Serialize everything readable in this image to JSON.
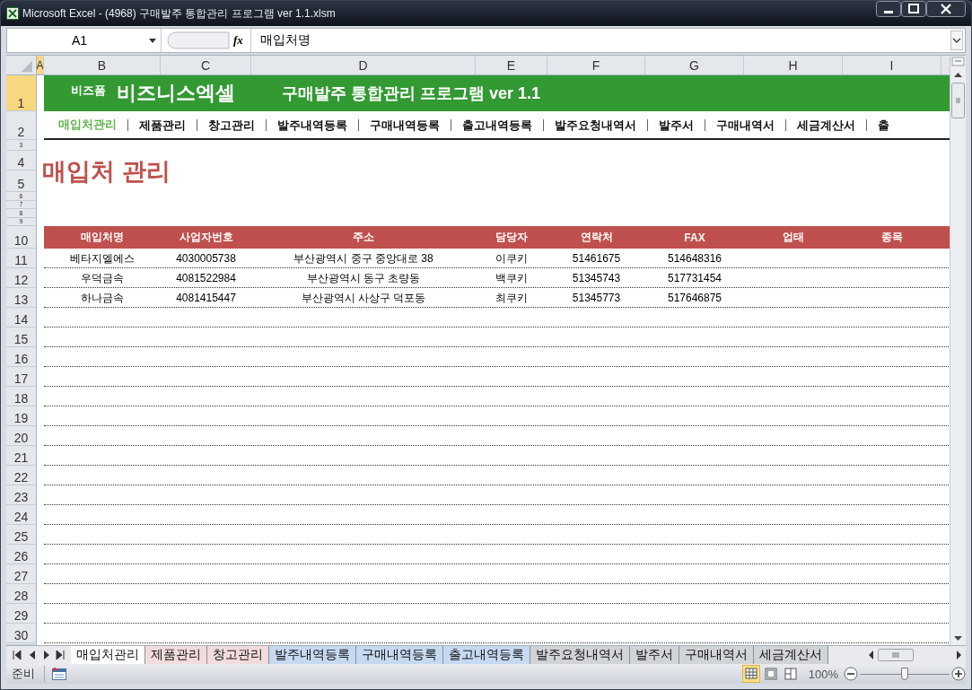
{
  "window": {
    "title": "Microsoft Excel - (4968) 구매발주 통합관리 프로그램 ver 1.1.xlsm"
  },
  "formula_bar": {
    "name_box": "A1",
    "function_button": "fx",
    "formula": "매입처명"
  },
  "column_headers": [
    "A",
    "B",
    "C",
    "D",
    "E",
    "F",
    "G",
    "H",
    "I"
  ],
  "row_headers": [
    "1",
    "2",
    "3",
    "4",
    "5",
    "6",
    "7",
    "8",
    "9",
    "10",
    "11",
    "12",
    "13",
    "14",
    "15",
    "16",
    "17",
    "18",
    "19",
    "20",
    "21",
    "22",
    "23",
    "24",
    "25",
    "26",
    "27",
    "28",
    "29",
    "30"
  ],
  "banner": {
    "brand_small": "비즈폼",
    "brand": "비즈니스엑셀",
    "title": "구매발주 통합관리 프로그램 ver 1.1"
  },
  "nav": [
    {
      "label": "매입처관리",
      "selected": true
    },
    {
      "label": "제품관리",
      "selected": false
    },
    {
      "label": "창고관리",
      "selected": false
    },
    {
      "label": "발주내역등록",
      "selected": false
    },
    {
      "label": "구매내역등록",
      "selected": false
    },
    {
      "label": "출고내역등록",
      "selected": false
    },
    {
      "label": "발주요청내역서",
      "selected": false
    },
    {
      "label": "발주서",
      "selected": false
    },
    {
      "label": "구매내역서",
      "selected": false
    },
    {
      "label": "세금계산서",
      "selected": false
    },
    {
      "label": "출",
      "selected": false
    }
  ],
  "page_title": "매입처 관리",
  "table": {
    "columns": [
      "매입처명",
      "사업자번호",
      "주소",
      "담당자",
      "연락처",
      "FAX",
      "업태",
      "종목"
    ],
    "rows": [
      [
        "베타지엘에스",
        "4030005738",
        "부산광역시 중구 중앙대로 38",
        "이쿠키",
        "51461675",
        "514648316"
      ],
      [
        "우덕금속",
        "4081522984",
        "부산광역시 동구 초량동",
        "백쿠키",
        "51345743",
        "517731454"
      ],
      [
        "하나금속",
        "4081415447",
        "부산광역시 사상구 덕포동",
        "최쿠키",
        "51345773",
        "517646875"
      ]
    ]
  },
  "sheet_tabs": [
    {
      "label": "매입처관리",
      "selected": true
    },
    {
      "label": "제품관리",
      "selected": false,
      "color": "#f2dcdb"
    },
    {
      "label": "창고관리",
      "selected": false,
      "color": "#f2dcdb"
    },
    {
      "label": "발주내역등록",
      "selected": false,
      "color": "#c6d9f1"
    },
    {
      "label": "구매내역등록",
      "selected": false,
      "color": "#c6d9f1"
    },
    {
      "label": "출고내역등록",
      "selected": false,
      "color": "#c6d9f1"
    },
    {
      "label": "발주요청내역서",
      "selected": false
    },
    {
      "label": "발주서",
      "selected": false
    },
    {
      "label": "구매내역서",
      "selected": false
    },
    {
      "label": "세금계산서",
      "selected": false
    }
  ],
  "status_bar": {
    "status": "준비",
    "zoom": "100%",
    "zoom_level": {
      "level": 0.5
    },
    "views": [
      {
        "selected": true
      },
      {
        "selected": false
      },
      {
        "selected": false
      }
    ]
  }
}
